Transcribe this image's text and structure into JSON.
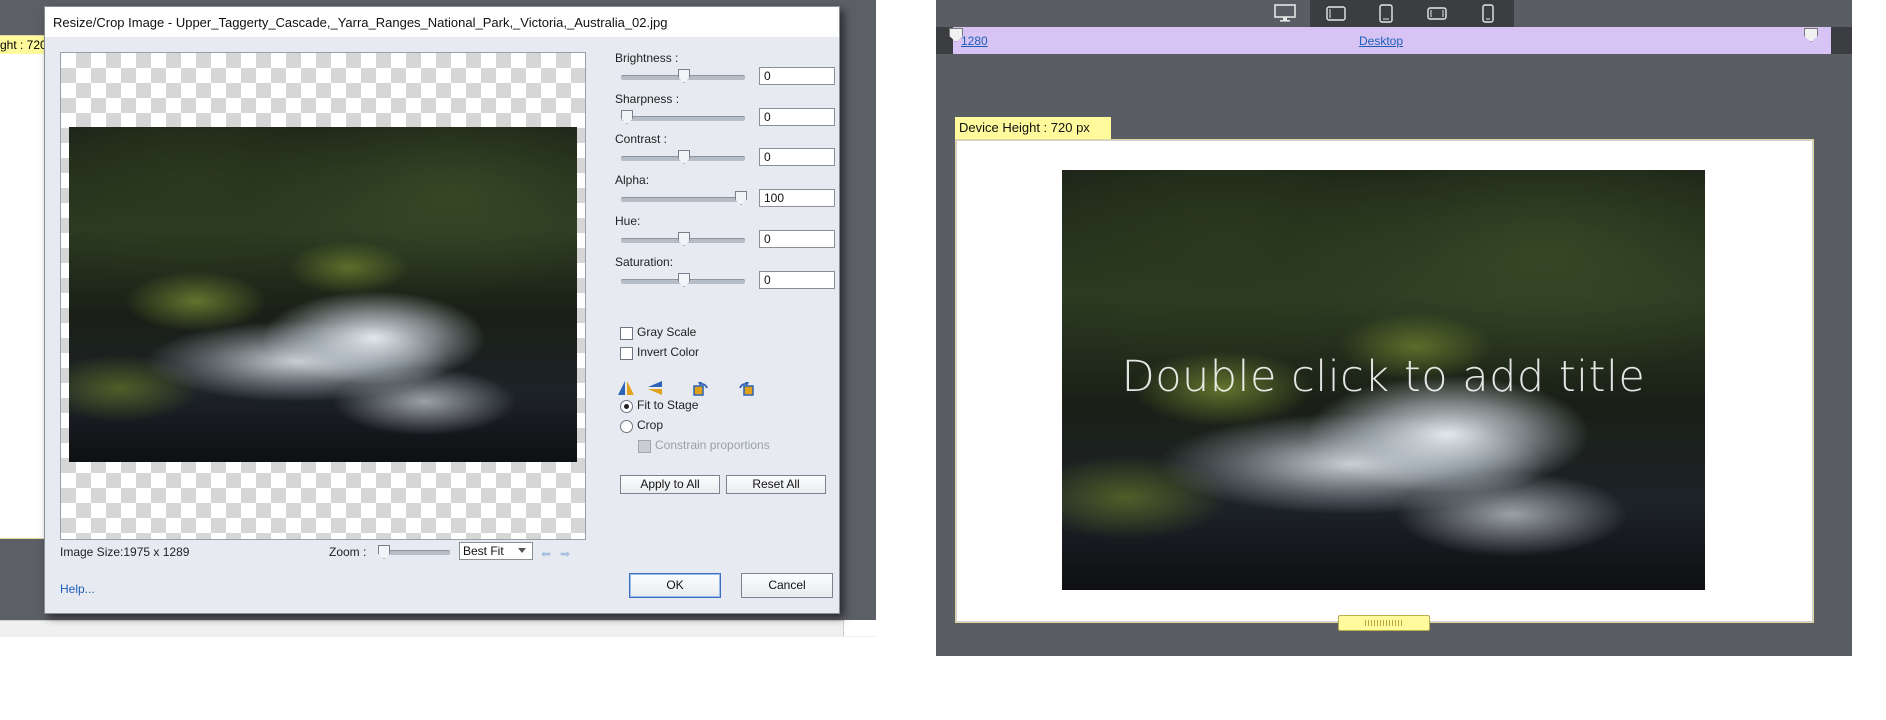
{
  "colors": {
    "dialog_bg": "#e7ebf1",
    "editor_gray": "#5a5d63",
    "ruler_purple": "#d7c4f5",
    "tag_yellow": "#fffb9c",
    "link_blue": "#1d5fb8"
  },
  "background_editor": {
    "height_tag_partial": "ght : 720"
  },
  "dialog": {
    "title": "Resize/Crop Image - Upper_Taggerty_Cascade,_Yarra_Ranges_National_Park,_Victoria,_Australia_02.jpg",
    "adjustments": [
      {
        "label": "Brightness :",
        "value": "0",
        "level": 0.5
      },
      {
        "label": "Sharpness :",
        "value": "0",
        "level": 0.0
      },
      {
        "label": "Contrast :",
        "value": "0",
        "level": 0.5
      },
      {
        "label": "Alpha:",
        "value": "100",
        "level": 1.0
      },
      {
        "label": "Hue:",
        "value": "0",
        "level": 0.5
      },
      {
        "label": "Saturation:",
        "value": "0",
        "level": 0.5
      }
    ],
    "gray_scale_label": "Gray Scale",
    "invert_color_label": "Invert Color",
    "gray_scale_checked": false,
    "invert_color_checked": false,
    "tool_icons": [
      "flip-horizontal-icon",
      "flip-vertical-icon",
      "rotate-left-icon",
      "rotate-right-icon"
    ],
    "fit_to_stage_label": "Fit to Stage",
    "crop_label": "Crop",
    "selected_mode": "Fit to Stage",
    "constrain_label": "Constrain proportions",
    "apply_all_label": "Apply to All",
    "reset_all_label": "Reset All",
    "image_size_text": "Image Size:1975 x 1289",
    "zoom_label": "Zoom :",
    "zoom_level": 0.0,
    "zoom_select_value": "Best Fit",
    "help_label": "Help...",
    "ok_label": "OK",
    "cancel_label": "Cancel"
  },
  "right_panel": {
    "device_tabs": [
      "desktop-icon",
      "tablet-landscape-icon",
      "tablet-portrait-icon",
      "phone-landscape-icon",
      "phone-portrait-icon"
    ],
    "active_device": "desktop-icon",
    "ruler_width_label": "1280",
    "ruler_device_label": "Desktop",
    "device_height_label": "Device Height : 720 px",
    "stage_title_placeholder": "Double click to add title"
  }
}
